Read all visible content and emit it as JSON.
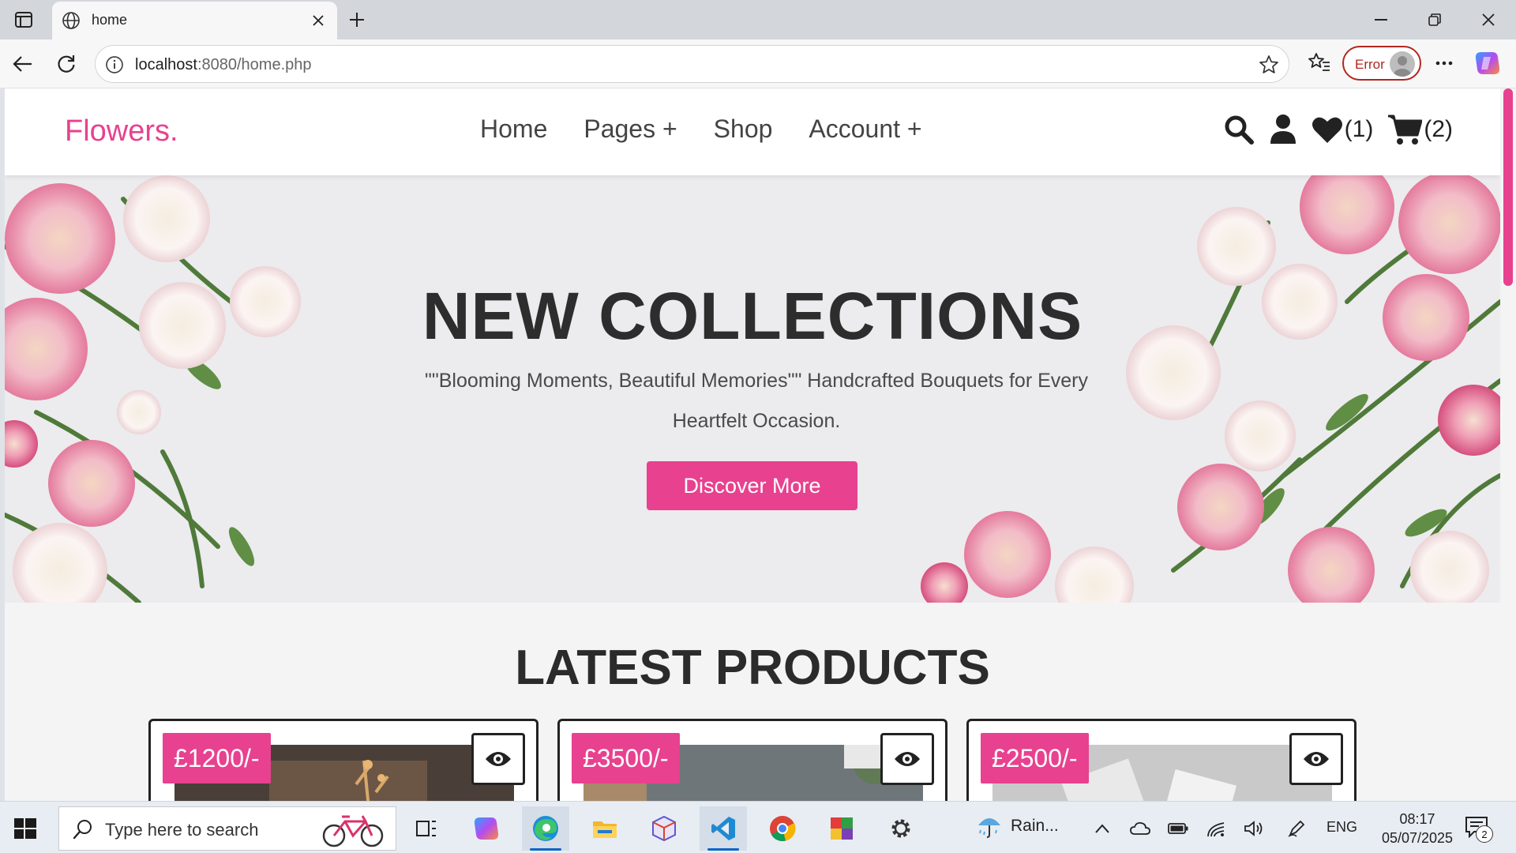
{
  "browser": {
    "tab_title": "home",
    "url_host": "localhost",
    "url_rest": ":8080/home.php",
    "profile_status": "Error"
  },
  "site": {
    "logo": "Flowers.",
    "nav": [
      "Home",
      "Pages +",
      "Shop",
      "Account +"
    ],
    "wishlist_count": "(1)",
    "cart_count": "(2)",
    "accent_color": "#e8418f"
  },
  "hero": {
    "title": "NEW COLLECTIONS",
    "subtitle": "\"\"Blooming Moments, Beautiful Memories\"\" Handcrafted Bouquets for Every Heartfelt Occasion.",
    "button_label": "Discover More"
  },
  "products": {
    "section_title": "LATEST PRODUCTS",
    "items": [
      {
        "price": "£1200/-",
        "icon": "eye-icon"
      },
      {
        "price": "£3500/-",
        "icon": "eye-icon"
      },
      {
        "price": "£2500/-",
        "icon": "eye-icon"
      }
    ]
  },
  "taskbar": {
    "search_placeholder": "Type here to search",
    "weather": "Rain...",
    "language": "ENG",
    "time": "08:17",
    "date": "05/07/2025",
    "notification_count": "2"
  }
}
